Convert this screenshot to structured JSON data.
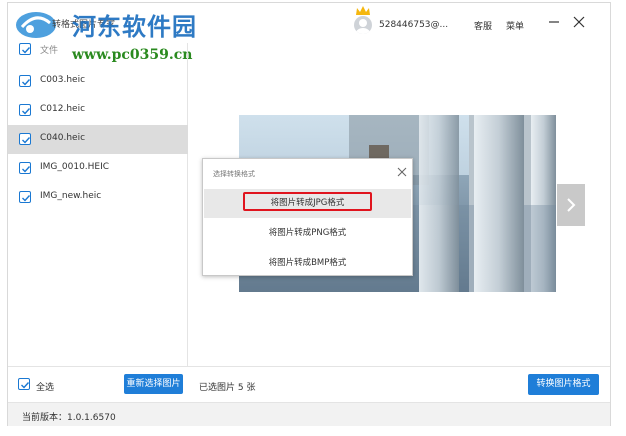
{
  "app": {
    "title": "转格式图片专家",
    "watermark_text": "河东软件园",
    "watermark_url": "www.pc0359.cn"
  },
  "titlebar": {
    "account_name": "528446753@...",
    "service_label": "客服",
    "menu_label": "菜单",
    "minimize_icon": "minimize-icon",
    "close_icon": "close-icon"
  },
  "file_list": {
    "partial_label": "文件",
    "items": [
      {
        "name": "C003.heic",
        "checked": true,
        "selected": false
      },
      {
        "name": "C012.heic",
        "checked": true,
        "selected": false
      },
      {
        "name": "C040.heic",
        "checked": true,
        "selected": true
      },
      {
        "name": "IMG_0010.HEIC",
        "checked": true,
        "selected": false
      },
      {
        "name": "IMG_new.heic",
        "checked": true,
        "selected": false
      }
    ]
  },
  "bottom": {
    "select_all_label": "全选",
    "select_all_checked": true,
    "reselect_label": "重新选择图片",
    "selected_count_text": "已选图片 5 张",
    "convert_label": "转换图片格式"
  },
  "status": {
    "version_text": "当前版本：1.0.1.6570"
  },
  "dialog": {
    "title": "选择转换格式",
    "options": [
      {
        "label": "将图片转成JPG格式",
        "highlighted": true
      },
      {
        "label": "将图片转成PNG格式",
        "highlighted": false
      },
      {
        "label": "将图片转成BMP格式",
        "highlighted": false
      }
    ]
  },
  "colors": {
    "accent": "#1f7ed8",
    "highlight": "#e0141e",
    "watermark_blue": "#1d6fbf",
    "watermark_green": "#2a8a1f"
  }
}
